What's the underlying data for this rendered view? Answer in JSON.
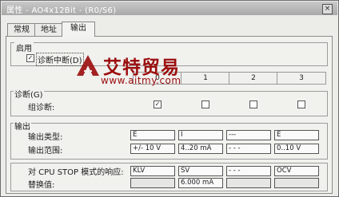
{
  "window": {
    "title": "属性 - AO4x12Bit - (R0/S6)",
    "close_glyph": "×"
  },
  "tabs": [
    "常规",
    "地址",
    "输出"
  ],
  "enable_group": {
    "label": "启用",
    "diag_interrupt": "诊断中断(D)",
    "diag_interrupt_checked": true
  },
  "columns": [
    "0",
    "1",
    "2",
    "3"
  ],
  "diagnostics": {
    "label": "诊断(G)",
    "group_diag": "组诊断:",
    "group_diag_checked": [
      true,
      false,
      false,
      false
    ]
  },
  "output": {
    "label": "输出",
    "type_label": "输出类型:",
    "types": [
      "E",
      "I",
      "---",
      "E"
    ],
    "range_label": "输出范围:",
    "ranges": [
      "+/- 10 V",
      "4..20 mA",
      "- - -",
      "0..10 V"
    ]
  },
  "cpu_stop": {
    "label": "对 CPU STOP 模式的响应:",
    "values": [
      "KLV",
      "SV",
      "- - -",
      "OCV"
    ],
    "replace_label": "替换值:",
    "replace_values": [
      "",
      "6.000   mA",
      "",
      ""
    ]
  },
  "watermark": {
    "title": "艾特贸易",
    "url": "www.aitmy.com"
  },
  "colors": {
    "watermark": "#9a0c0c"
  }
}
